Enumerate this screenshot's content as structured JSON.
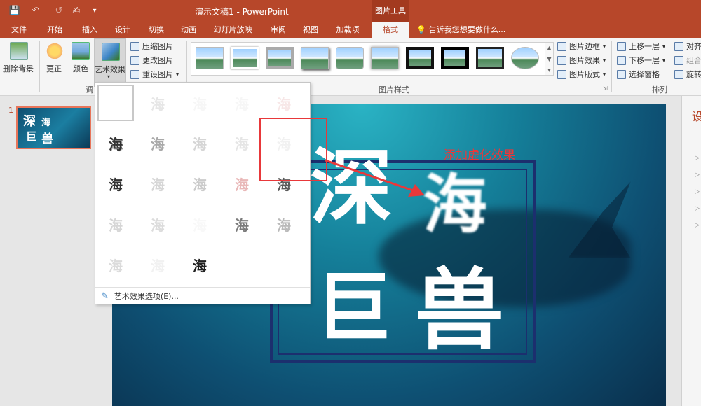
{
  "title": "演示文稿1 - PowerPoint",
  "context_group": "图片工具",
  "tabs": [
    {
      "label": "文件"
    },
    {
      "label": "开始"
    },
    {
      "label": "插入"
    },
    {
      "label": "设计"
    },
    {
      "label": "切换"
    },
    {
      "label": "动画"
    },
    {
      "label": "幻灯片放映"
    },
    {
      "label": "审阅"
    },
    {
      "label": "视图"
    },
    {
      "label": "加载项"
    },
    {
      "label": "格式"
    }
  ],
  "tell_me": "告诉我您想要做什么...",
  "ribbon": {
    "remove_bg": "删除背景",
    "corrections": "更正",
    "color": "颜色",
    "artistic": "艺术效果",
    "compress": "压缩图片",
    "change": "更改图片",
    "reset": "重设图片",
    "adjust_group": "调",
    "styles_group": "图片样式",
    "arrange_group": "排列",
    "border": "图片边框",
    "effects": "图片效果",
    "layout": "图片版式",
    "bring_forward": "上移一层",
    "send_backward": "下移一层",
    "selection_pane": "选择窗格",
    "align": "对齐",
    "group": "组合",
    "rotate": "旋转"
  },
  "thumbnail": {
    "number": "1",
    "chars": [
      "深",
      "海",
      "巨",
      "兽"
    ]
  },
  "slide": {
    "chars": [
      "深",
      "海",
      "巨",
      "兽"
    ]
  },
  "artistic_menu": {
    "effect_char": "海",
    "option": "艺术效果选项(E)..."
  },
  "right_panel": {
    "label": "设"
  },
  "annotation": "添加虚化效果",
  "colors": {
    "accent": "#b7472a",
    "annotation": "#e8383a"
  }
}
